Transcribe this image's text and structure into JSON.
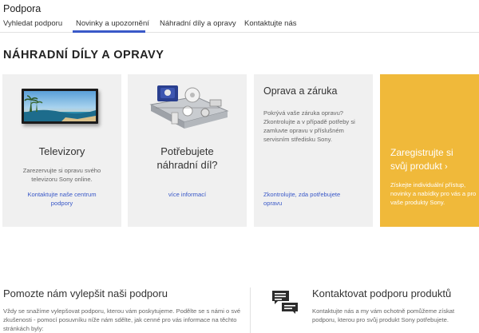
{
  "header": {
    "title": "Podpora",
    "tabs": [
      {
        "label": "Vyhledat podporu"
      },
      {
        "label": "Novinky a upozornění"
      },
      {
        "label": "Náhradní díly a opravy"
      },
      {
        "label": "Kontaktujte nás"
      }
    ]
  },
  "main": {
    "section_title": "NÁHRADNÍ DÍLY A OPRAVY",
    "cards": [
      {
        "heading": "Televizory",
        "description": "Zarezervujte si opravu svého televizoru Sony online.",
        "link": "Kontaktujte naše centrum podpory"
      },
      {
        "heading": "Potřebujete náhradní díl?",
        "description": "",
        "link": "více informací"
      },
      {
        "heading": "Oprava a záruka",
        "description": "Pokrývá vaše záruka opravu? Zkontrolujte a v případě potřeby si zamluvte opravu v příslušném servisním středisku Sony.",
        "link": "Zkontrolujte, zda potřebujete opravu"
      },
      {
        "heading_line1": "Zaregistrujte si",
        "heading_line2": "svůj produkt",
        "arrow": "›",
        "description": "Získejte individuální přístup, novinky a nabídky pro vás a pro vaše produkty Sony."
      }
    ]
  },
  "footer": {
    "left_title": "Pomozte nám vylepšit naši podporu",
    "left_text": "Vždy se snažíme vylepšovat podporu, kterou vám poskytujeme. Podělte se s námi o své zkušenosti - pomocí posuvníku níže nám sdělte, jak cenné pro vás informace na těchto stránkách byly:",
    "right_title": "Kontaktovat podporu produktů",
    "right_text": "Kontaktujte nás a my vám ochotně pomůžeme získat podporu, kterou pro svůj produkt Sony potřebujete."
  },
  "colors": {
    "accent": "#3a59c8",
    "register_card": "#f0b93a"
  }
}
